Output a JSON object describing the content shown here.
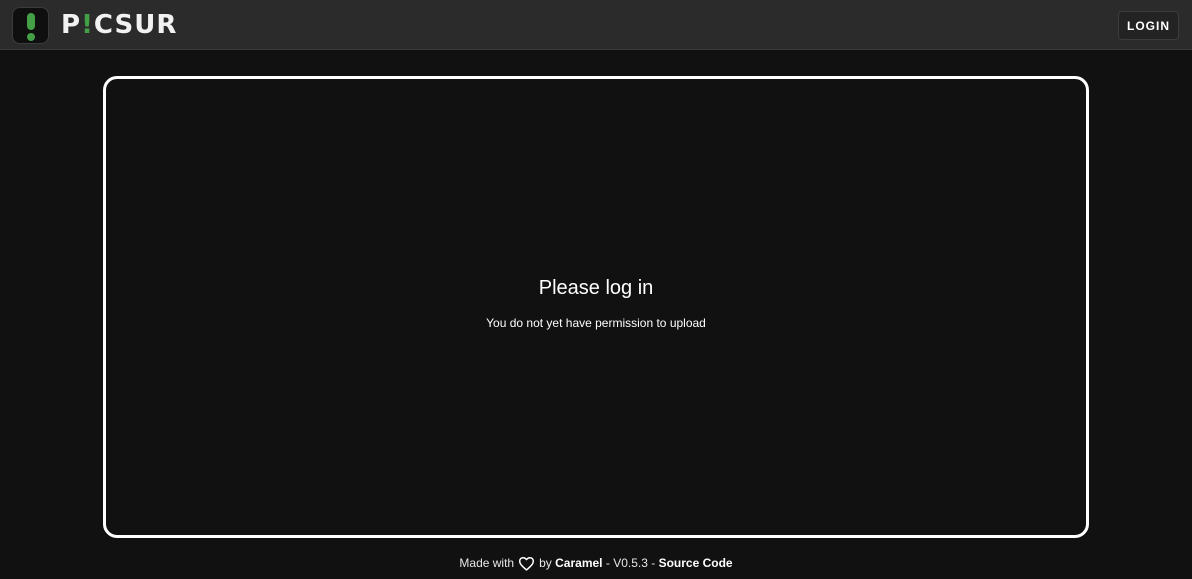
{
  "header": {
    "logo_text_prefix": "P",
    "logo_text_accent": "!",
    "logo_text_suffix": "CSUR",
    "login_label": "LOGIN"
  },
  "panel": {
    "title": "Please log in",
    "subtitle": "You do not yet have permission to upload"
  },
  "footer": {
    "made_with": "Made with",
    "by": "by",
    "author": "Caramel",
    "version": "- V0.5.3 -",
    "source_link": "Source Code",
    "heart_icon": "heart-icon"
  },
  "colors": {
    "brand_green": "#43a047",
    "background": "#111111",
    "topbar": "#2b2b2b"
  }
}
